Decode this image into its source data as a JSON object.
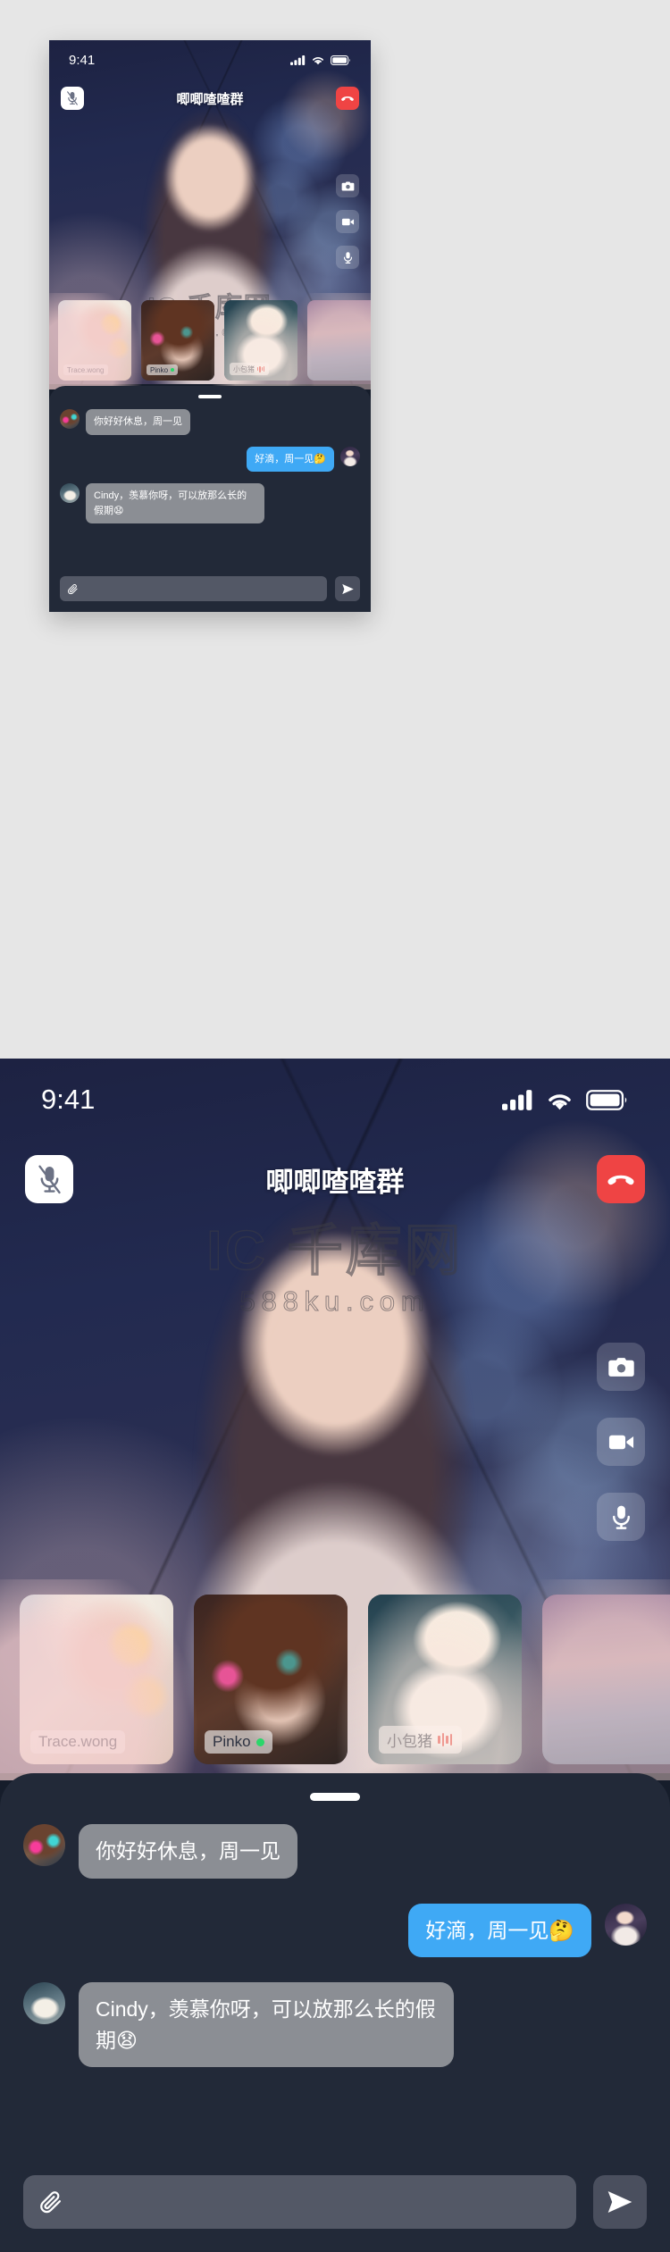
{
  "status_bar": {
    "time": "9:41",
    "icons": [
      "cellular-signal-icon",
      "wifi-icon",
      "battery-icon"
    ]
  },
  "call": {
    "title": "唧唧喳喳群",
    "mute_icon": "microphone-muted-icon",
    "hangup_icon": "phone-hangup-icon",
    "controls": [
      {
        "name": "camera-button",
        "icon": "camera-icon"
      },
      {
        "name": "video-button",
        "icon": "video-camera-icon"
      },
      {
        "name": "microphone-button",
        "icon": "microphone-icon"
      }
    ]
  },
  "participants": [
    {
      "name": "Trace.wong",
      "status": "none"
    },
    {
      "name": "Pinko",
      "status": "online"
    },
    {
      "name": "小包猪",
      "status": "speaking"
    },
    {
      "name": "",
      "status": "none"
    }
  ],
  "chat": {
    "grabber": "drag-handle",
    "messages": [
      {
        "side": "in",
        "avatar": "av-a",
        "text": "你好好休息，周一见"
      },
      {
        "side": "out",
        "avatar": "av-c",
        "text": "好滴，周一见🤔"
      },
      {
        "side": "in",
        "avatar": "av-b",
        "text": "Cindy，羡慕你呀，可以放那么长的假期😧"
      }
    ],
    "composer": {
      "attach_icon": "paperclip-icon",
      "input_value": "",
      "input_placeholder": "",
      "send_icon": "send-arrow-icon"
    }
  },
  "watermark": {
    "main": "IC 千库网",
    "sub": "588ku.com"
  },
  "colors": {
    "accent_blue": "#3fa9f5",
    "hangup_red": "#ef4444",
    "chat_bg": "#222938",
    "bubble_in": "#8b8e94",
    "online_green": "#2bd66a"
  }
}
